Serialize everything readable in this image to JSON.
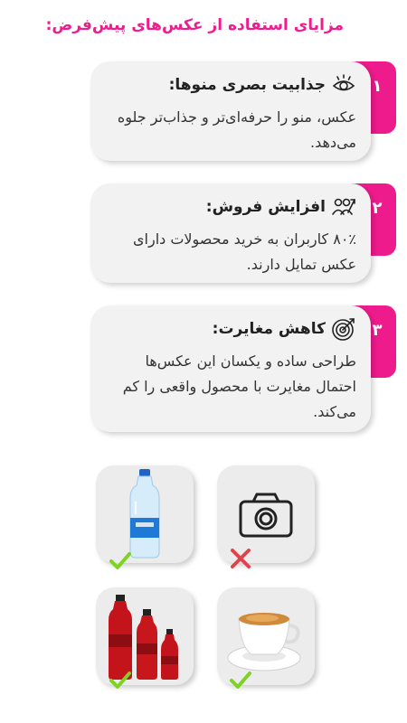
{
  "title": "مزایای استفاده از عکس‌های پیش‌فرض:",
  "features": [
    {
      "number": "۱",
      "title": "جذابیت بصری منوها:",
      "text": "عکس، منو را حرفه‌ای‌تر و جذاب‌تر جلوه می‌دهد.",
      "icon": "eye-icon"
    },
    {
      "number": "۲",
      "title": "افزایش فروش:",
      "text": "۸۰٪ کاربران به خرید محصولات دارای عکس تمایل دارند.",
      "icon": "people-growth-icon"
    },
    {
      "number": "۳",
      "title": "کاهش مغایرت:",
      "text": "طراحی ساده و یکسان این عکس‌ها احتمال مغایرت با محصول واقعی را کم می‌کند.",
      "icon": "target-icon"
    }
  ],
  "examples": [
    {
      "subject": "camera-placeholder-icon",
      "status": "wrong"
    },
    {
      "subject": "water-bottle-image",
      "status": "correct"
    },
    {
      "subject": "coffee-cup-image",
      "status": "correct"
    },
    {
      "subject": "red-drink-bottles-image",
      "status": "correct"
    }
  ],
  "colors": {
    "accent": "#ee1b8c",
    "card": "#f2f2f2",
    "check": "#7ed321",
    "cross": "#e0434a"
  }
}
